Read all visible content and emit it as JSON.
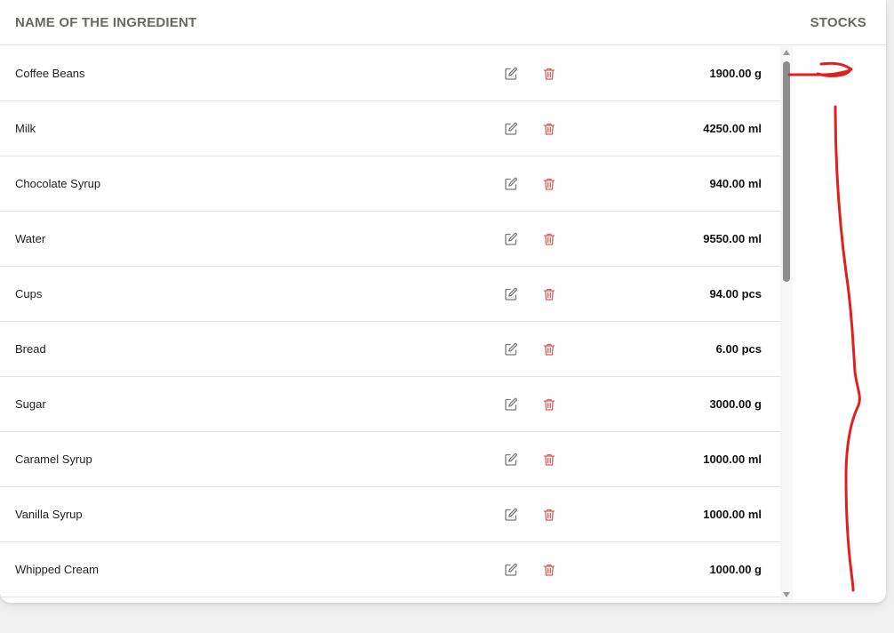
{
  "header": {
    "name_column": "NAME OF THE INGREDIENT",
    "stocks_column": "STOCKS"
  },
  "ingredients": [
    {
      "name": "Coffee Beans",
      "stock": "1900.00 g"
    },
    {
      "name": "Milk",
      "stock": "4250.00 ml"
    },
    {
      "name": "Chocolate Syrup",
      "stock": "940.00 ml"
    },
    {
      "name": "Water",
      "stock": "9550.00 ml"
    },
    {
      "name": "Cups",
      "stock": "94.00 pcs"
    },
    {
      "name": "Bread",
      "stock": "6.00 pcs"
    },
    {
      "name": "Sugar",
      "stock": "3000.00 g"
    },
    {
      "name": "Caramel Syrup",
      "stock": "1000.00 ml"
    },
    {
      "name": "Vanilla Syrup",
      "stock": "1000.00 ml"
    },
    {
      "name": "Whipped Cream",
      "stock": "1000.00 g"
    }
  ],
  "icons": {
    "edit": "edit-icon",
    "delete": "trash-icon"
  },
  "colors": {
    "edit_icon": "#7a7a7a",
    "delete_icon": "#e05a5a",
    "annotation": "#e02020",
    "header_text": "#6b6864"
  }
}
